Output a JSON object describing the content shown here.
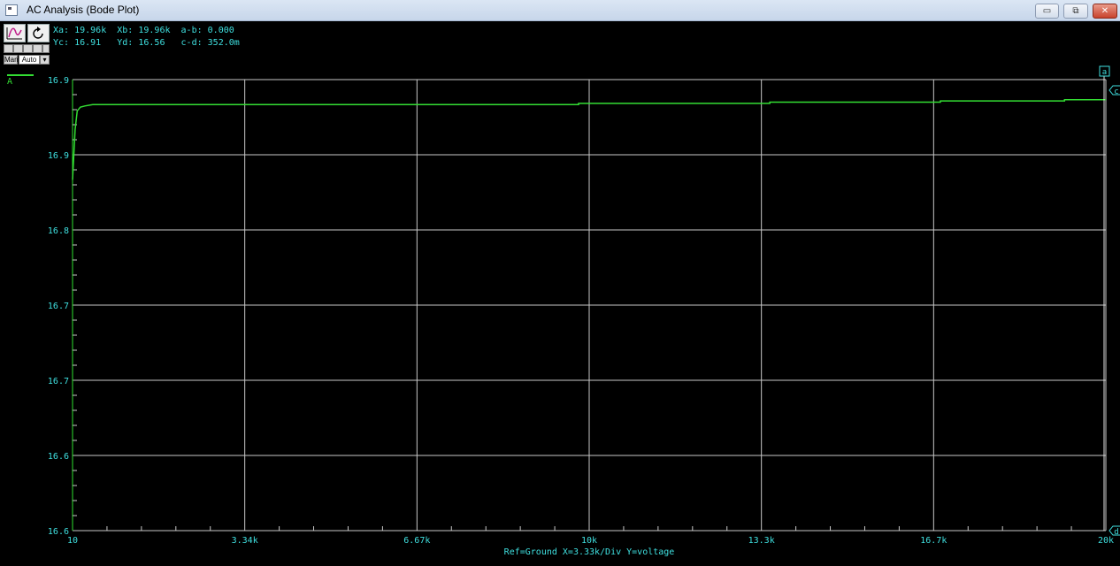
{
  "window": {
    "title": "AC Analysis (Bode Plot)",
    "buttons": {
      "minimize": "▭",
      "restore": "⧉",
      "close": "✕"
    }
  },
  "toolbar": {
    "man_label": "Man",
    "auto_label": "Auto"
  },
  "readouts": {
    "xa_label": "Xa:",
    "xa_value": "19.96k",
    "xb_label": "Xb:",
    "xb_value": "19.96k",
    "ab_label": "a-b:",
    "ab_value": "0.000",
    "yc_label": "Yc:",
    "yc_value": "16.91",
    "yd_label": "Yd:",
    "yd_value": "16.56",
    "cd_label": "c-d:",
    "cd_value": "352.0m"
  },
  "plot": {
    "trace_label": "A",
    "footer": "Ref=Ground  X=3.33k/Div Y=voltage",
    "cursor_a_label": "a",
    "cursor_c_label": "c",
    "cursor_d_label": "d",
    "colors": {
      "background": "#000000",
      "grid": "#c8c8c8",
      "axis_text": "#3fe0e0",
      "trace": "#33dd33",
      "axis_line": "#2ee02e"
    }
  },
  "chart_data": {
    "type": "line",
    "title": "",
    "xlabel": "",
    "ylabel": "",
    "x_tick_labels": [
      "10",
      "3.34k",
      "6.67k",
      "10k",
      "13.3k",
      "16.7k",
      "20k"
    ],
    "y_tick_labels": [
      "16.9",
      "16.9",
      "16.8",
      "16.7",
      "16.7",
      "16.6",
      "16.6"
    ],
    "xlim": [
      10,
      20000
    ],
    "ylim": [
      16.56,
      16.92
    ],
    "grid": true,
    "series": [
      {
        "name": "A",
        "x": [
          10,
          60,
          100,
          160,
          250,
          400,
          800,
          9800,
          9800,
          13500,
          13500,
          16800,
          16800,
          19200,
          19200,
          20000
        ],
        "y": [
          16.84,
          16.88,
          16.895,
          16.898,
          16.899,
          16.9,
          16.9,
          16.9,
          16.901,
          16.901,
          16.902,
          16.902,
          16.903,
          16.903,
          16.904,
          16.904
        ]
      }
    ]
  }
}
